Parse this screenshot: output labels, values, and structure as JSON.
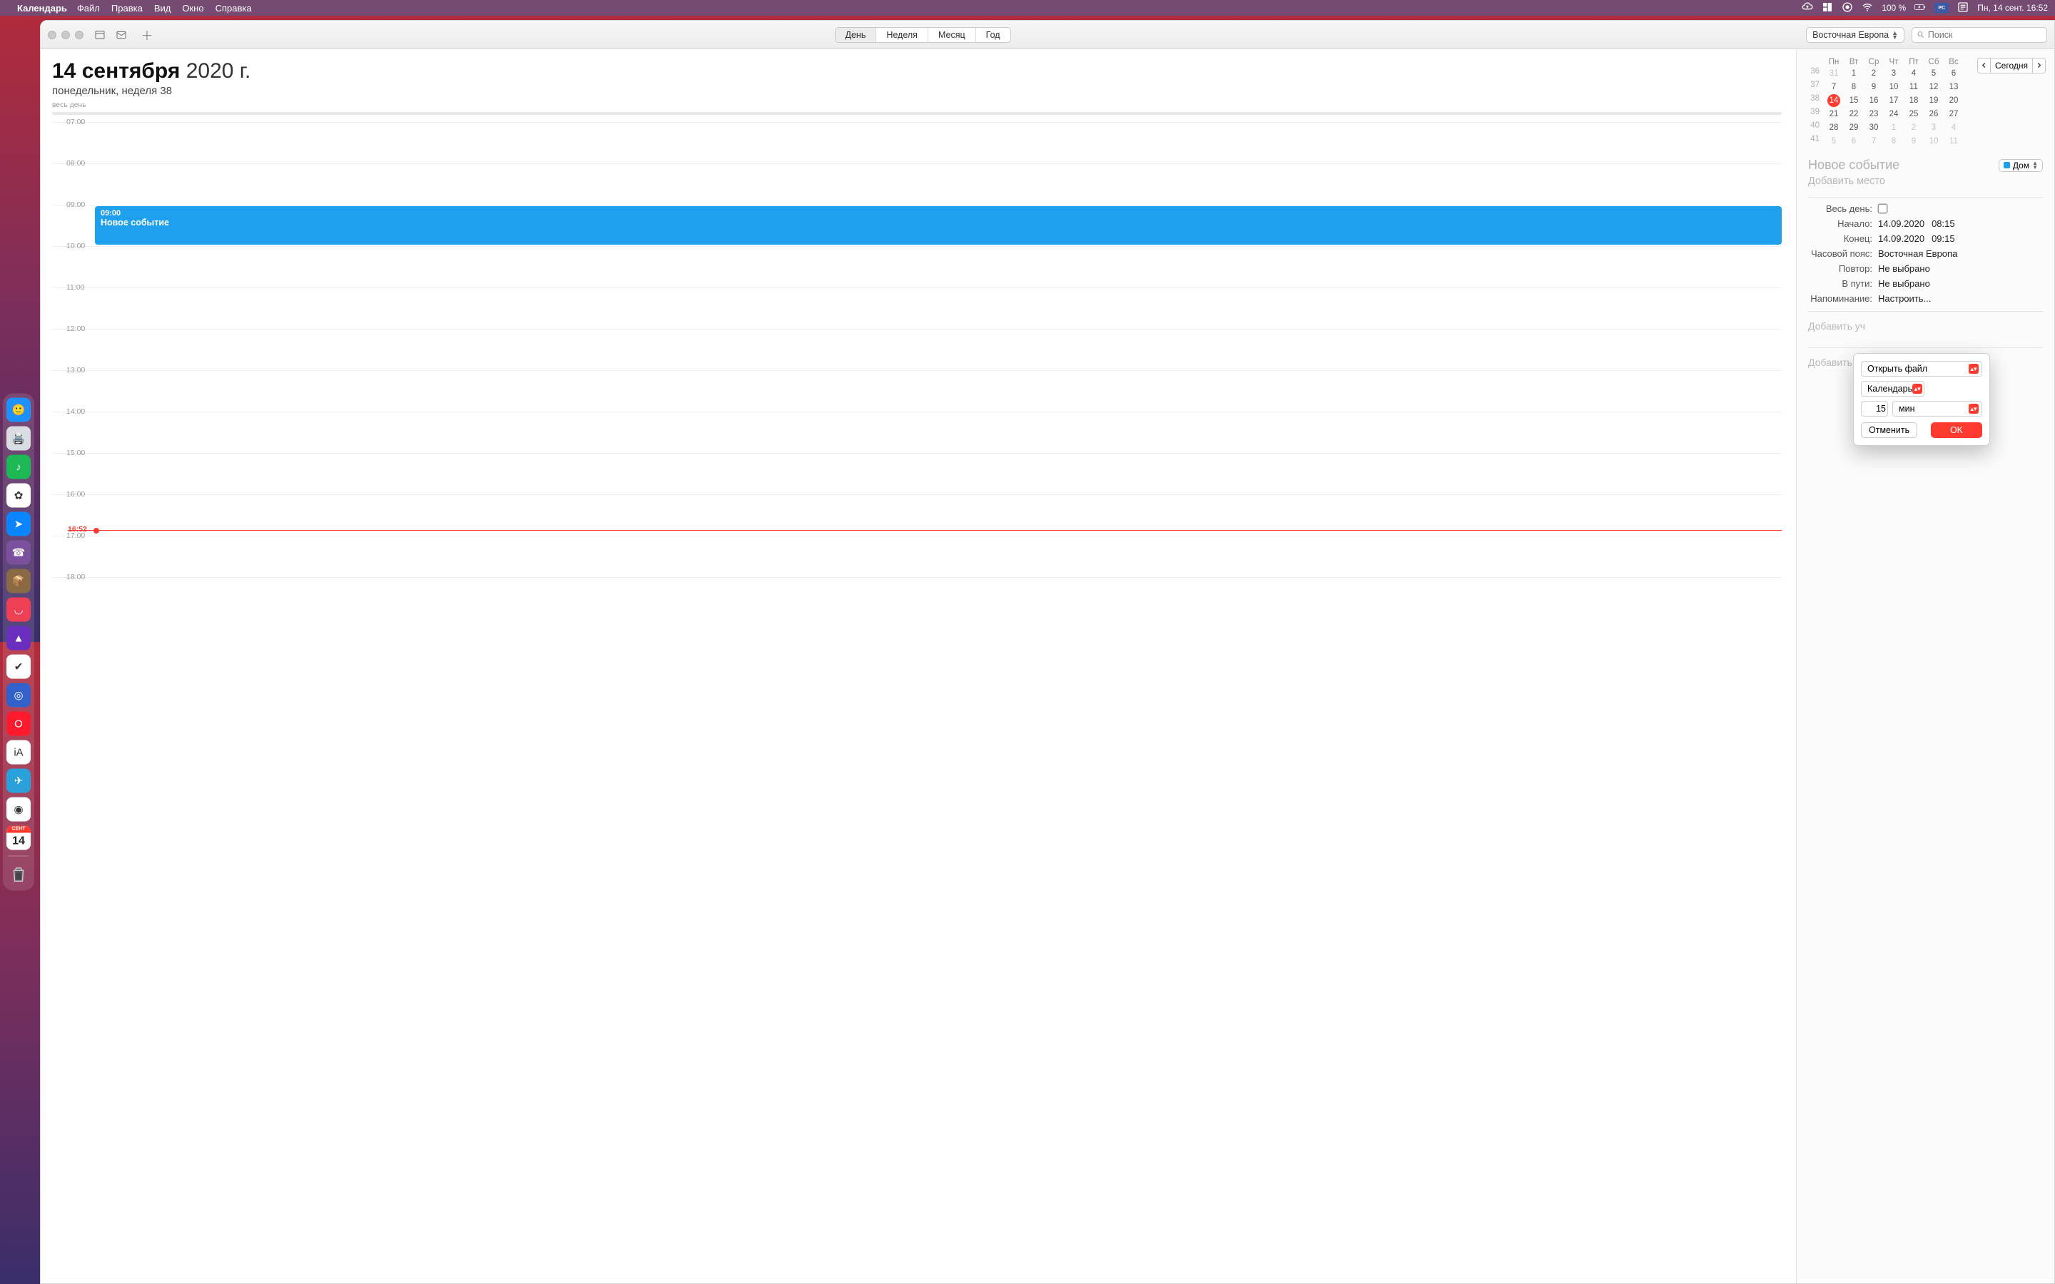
{
  "menubar": {
    "app": "Календарь",
    "items": [
      "Файл",
      "Правка",
      "Вид",
      "Окно",
      "Справка"
    ],
    "battery": "100 %",
    "clock": "Пн, 14 сент.  16:52"
  },
  "dock": {
    "apps": [
      {
        "name": "finder-icon",
        "bg": "#1e90ff",
        "glyph": "🙂"
      },
      {
        "name": "scanner-icon",
        "bg": "#d9dde2",
        "glyph": "🖨️"
      },
      {
        "name": "spotify-icon",
        "bg": "#1db954",
        "glyph": "♪"
      },
      {
        "name": "photos-icon",
        "bg": "#ffffff",
        "glyph": "✿"
      },
      {
        "name": "maps-icon",
        "bg": "#0a84ff",
        "glyph": "➤"
      },
      {
        "name": "viber-icon",
        "bg": "#7b519d",
        "glyph": "☎"
      },
      {
        "name": "package-icon",
        "bg": "#8a6a44",
        "glyph": "📦"
      },
      {
        "name": "pocket-icon",
        "bg": "#ef4056",
        "glyph": "◡"
      },
      {
        "name": "affinity-icon",
        "bg": "#6b2fbf",
        "glyph": "▲"
      },
      {
        "name": "things-icon",
        "bg": "#fff",
        "glyph": "✔"
      },
      {
        "name": "simplenote-icon",
        "bg": "#3361cc",
        "glyph": "◎"
      },
      {
        "name": "opera-icon",
        "bg": "#ff1b2d",
        "glyph": "O"
      },
      {
        "name": "ia-writer-icon",
        "bg": "#fff",
        "glyph": "iA"
      },
      {
        "name": "telegram-icon",
        "bg": "#2aa1da",
        "glyph": "✈"
      },
      {
        "name": "chrome-icon",
        "bg": "#fff",
        "glyph": "◉"
      },
      {
        "name": "calendar-icon",
        "bg": "#fff",
        "glyph": "14"
      }
    ],
    "cal_month_short": "СЕНТ",
    "cal_day": "14"
  },
  "toolbar": {
    "view_tabs": [
      "День",
      "Неделя",
      "Месяц",
      "Год"
    ],
    "selected_tab": 0,
    "timezone": "Восточная Европа",
    "search_placeholder": "Поиск"
  },
  "header": {
    "date_bold": "14 сентября",
    "date_rest": " 2020 г.",
    "subtitle": "понедельник, неделя 38",
    "all_day_label": "весь день"
  },
  "hours": [
    "07:00",
    "08:00",
    "09:00",
    "10:00",
    "11:00",
    "12:00",
    "13:00",
    "14:00",
    "15:00",
    "16:00",
    "17:00",
    "18:00"
  ],
  "event": {
    "time": "09:00",
    "title": "Новое событие"
  },
  "now": {
    "label": "16:52"
  },
  "mini_cal": {
    "weekdays": [
      "Пн",
      "Вт",
      "Ср",
      "Чт",
      "Пт",
      "Сб",
      "Вс"
    ],
    "today_button": "Сегодня",
    "rows": [
      {
        "wk": "36",
        "days": [
          {
            "n": "31",
            "off": true
          },
          "1",
          "2",
          "3",
          "4",
          "5",
          "6"
        ]
      },
      {
        "wk": "37",
        "days": [
          "7",
          "8",
          "9",
          "10",
          "11",
          "12",
          "13"
        ]
      },
      {
        "wk": "38",
        "days": [
          {
            "n": "14",
            "today": true
          },
          "15",
          "16",
          "17",
          "18",
          "19",
          "20"
        ]
      },
      {
        "wk": "39",
        "days": [
          "21",
          "22",
          "23",
          "24",
          "25",
          "26",
          "27"
        ]
      },
      {
        "wk": "40",
        "days": [
          "28",
          "29",
          "30",
          {
            "n": "1",
            "off": true
          },
          {
            "n": "2",
            "off": true
          },
          {
            "n": "3",
            "off": true
          },
          {
            "n": "4",
            "off": true
          }
        ]
      },
      {
        "wk": "41",
        "days": [
          {
            "n": "5",
            "off": true
          },
          {
            "n": "6",
            "off": true
          },
          {
            "n": "7",
            "off": true
          },
          {
            "n": "8",
            "off": true
          },
          {
            "n": "9",
            "off": true
          },
          {
            "n": "10",
            "off": true
          },
          {
            "n": "11",
            "off": true
          }
        ]
      }
    ]
  },
  "inspector": {
    "title_placeholder": "Новое событие",
    "calendar_name": "Дом",
    "location_placeholder": "Добавить место",
    "allday_label": "Весь день:",
    "start_label": "Начало:",
    "start_date": "14.09.2020",
    "start_time": "08:15",
    "end_label": "Конец:",
    "end_date": "14.09.2020",
    "end_time": "09:15",
    "tz_label": "Часовой пояс:",
    "tz_value": "Восточная Европа",
    "repeat_label": "Повтор:",
    "repeat_value": "Не выбрано",
    "travel_label": "В пути:",
    "travel_value": "Не выбрано",
    "alert_label": "Напоминание:",
    "alert_value": "Настроить...",
    "add_attendees": "Добавить уч",
    "add_notes": "Добавить за"
  },
  "popup": {
    "open_file": "Открыть файл",
    "calendar": "Календарь",
    "minutes_value": "15",
    "minutes_unit": "мин",
    "cancel": "Отменить",
    "ok": "OK"
  }
}
